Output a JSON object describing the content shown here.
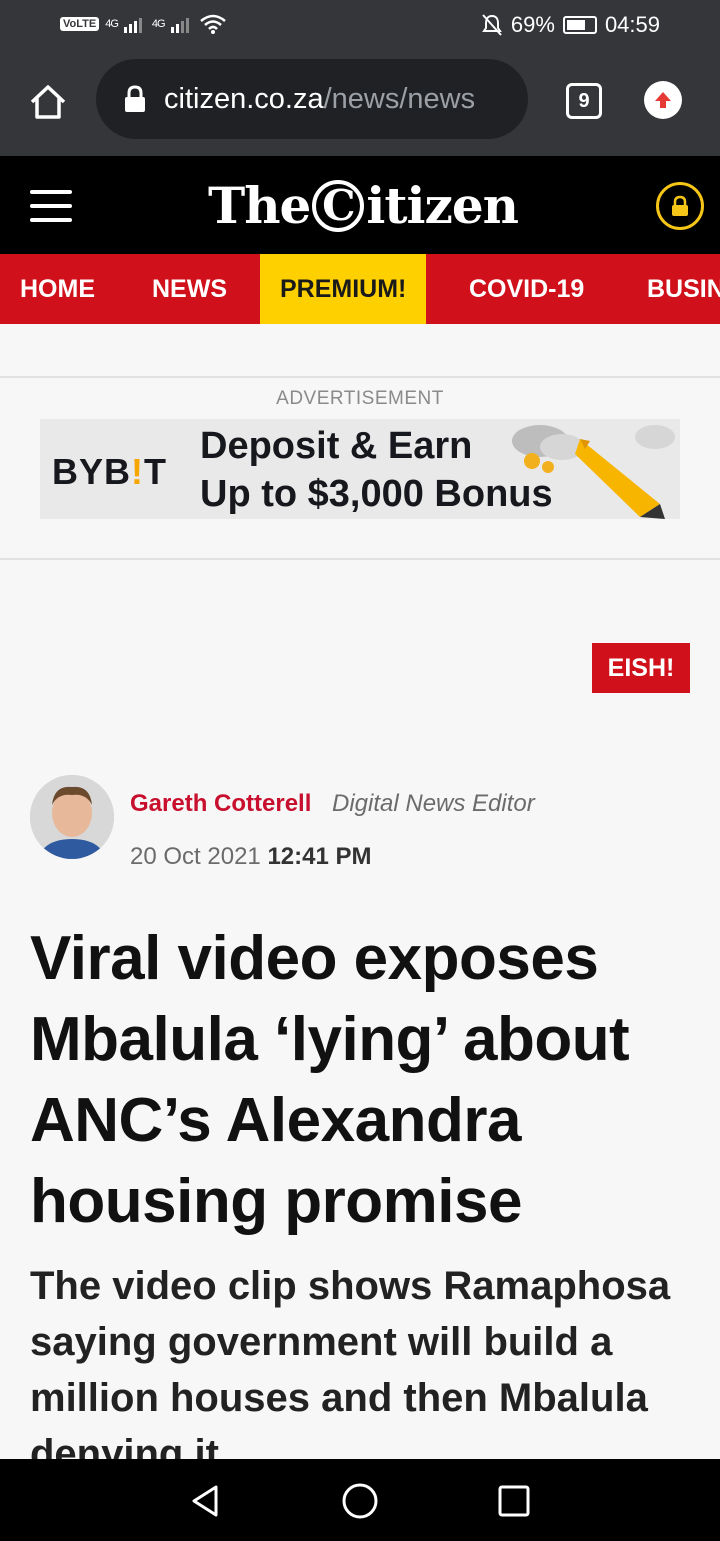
{
  "status_bar": {
    "volte": "VoLTE",
    "network1": "4G",
    "network2": "4G",
    "battery": "69%",
    "time": "04:59"
  },
  "browser": {
    "url_host": "citizen.co.za",
    "url_path": "/news/news",
    "tab_count": "9"
  },
  "site": {
    "logo_part1": "The",
    "logo_c": "C",
    "logo_part2": "itizen"
  },
  "nav": {
    "items": [
      "HOME",
      "NEWS",
      "PREMIUM!",
      "COVID-19",
      "BUSINESS"
    ]
  },
  "ad": {
    "label": "ADVERTISEMENT",
    "brand_a": "BYB",
    "brand_tick": "!",
    "brand_b": "T",
    "line1": "Deposit & Earn",
    "line2": "Up to $3,000 Bonus"
  },
  "article": {
    "tag": "EISH!",
    "author_name": "Gareth Cotterell",
    "author_role": "Digital News Editor",
    "date": "20 Oct 2021",
    "time": "12:41 PM",
    "headline": "Viral video exposes Mbalula ‘lying’ about ANC’s Alexandra housing promise",
    "subheadline": "The video clip shows Ramaphosa saying government will build a million houses and then Mbalula denying it."
  },
  "colors": {
    "brand_red": "#d0111b",
    "premium_yellow": "#ffd000",
    "chrome_dark": "#35363a"
  }
}
